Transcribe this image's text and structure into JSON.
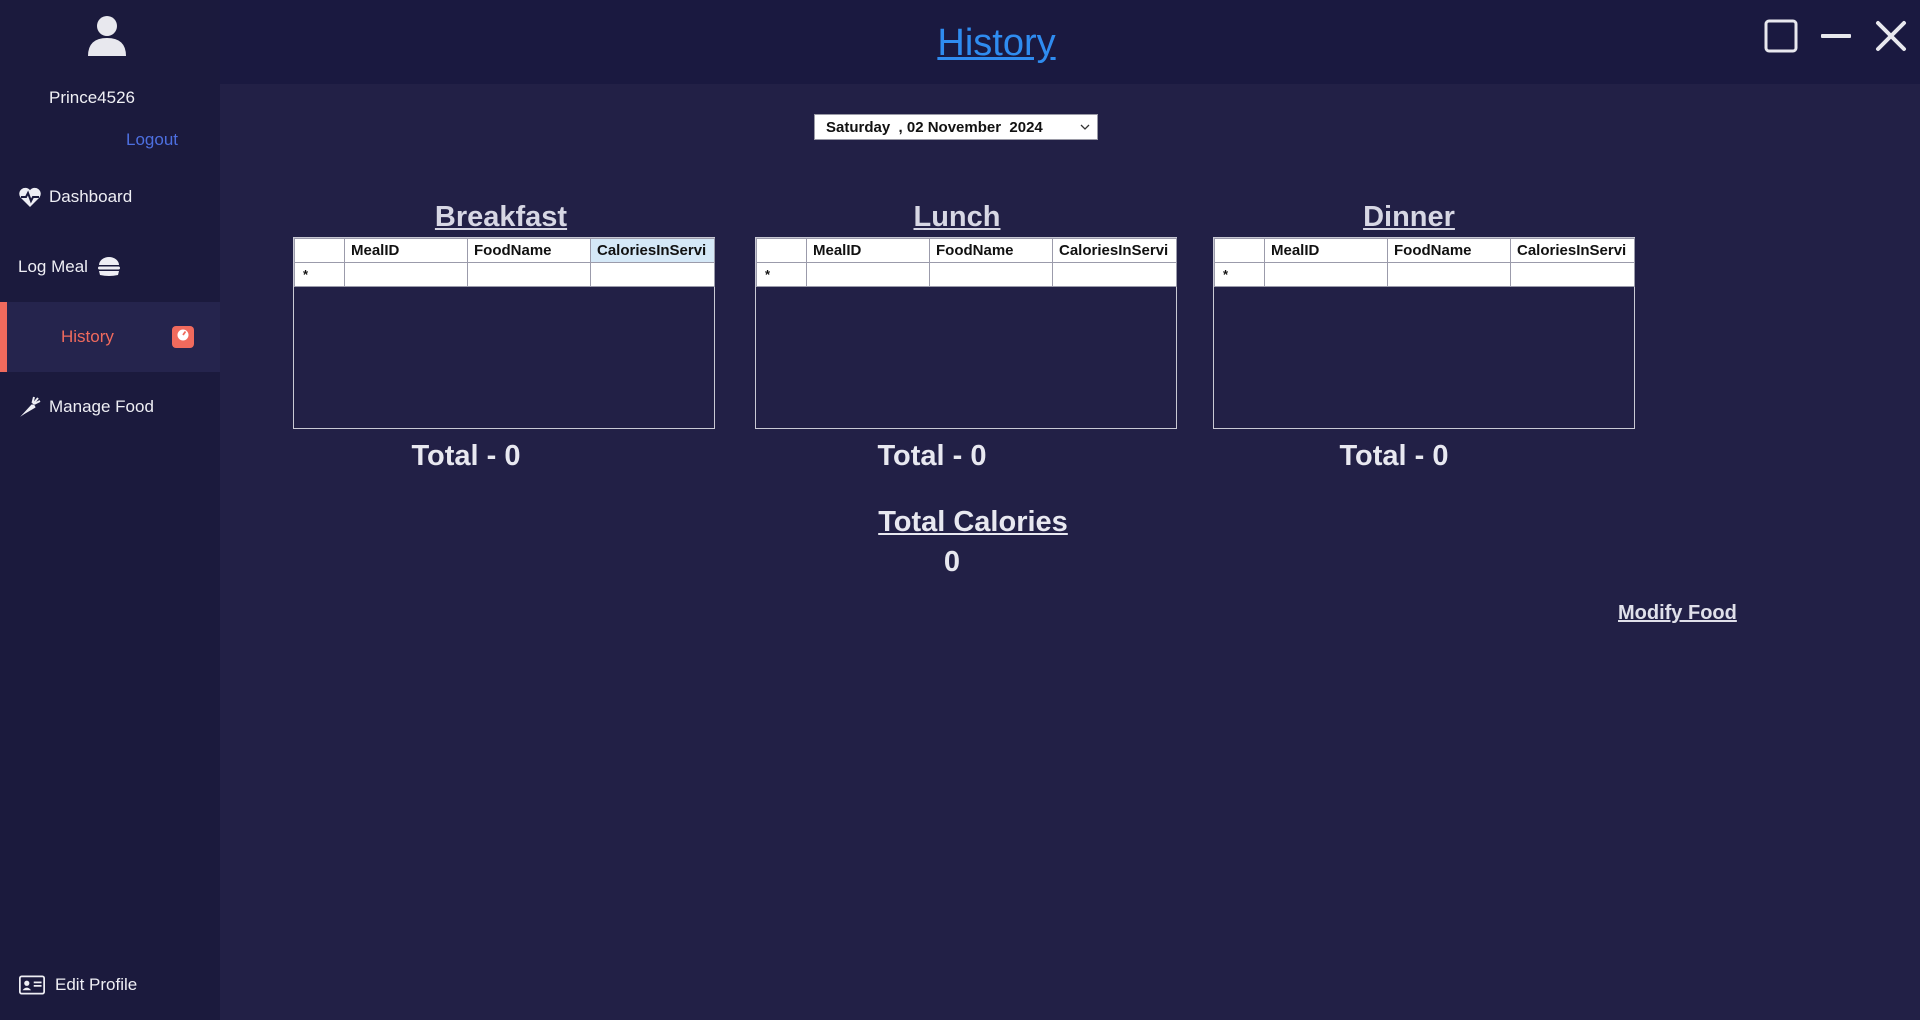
{
  "sidebar": {
    "username": "Prince4526",
    "logout": "Logout",
    "items": [
      {
        "label": "Dashboard",
        "icon": "heart-pulse-icon"
      },
      {
        "label": "Log Meal",
        "icon": "burger-icon"
      },
      {
        "label": "History",
        "icon": "scale-icon",
        "active": true
      },
      {
        "label": "Manage Food",
        "icon": "carrot-icon"
      }
    ],
    "edit_profile": "Edit Profile"
  },
  "header": {
    "title": "History"
  },
  "date_picker": {
    "value": "Saturday  , 02 November  2024"
  },
  "meals": [
    {
      "title": "Breakfast",
      "columns": [
        "",
        "MealID",
        "FoodName",
        "CaloriesInServi"
      ],
      "new_row_marker": "*",
      "total": "Total - 0"
    },
    {
      "title": "Lunch",
      "columns": [
        "",
        "MealID",
        "FoodName",
        "CaloriesInServi"
      ],
      "new_row_marker": "*",
      "total": "Total - 0"
    },
    {
      "title": "Dinner",
      "columns": [
        "",
        "MealID",
        "FoodName",
        "CaloriesInServi"
      ],
      "new_row_marker": "*",
      "total": "Total - 0"
    }
  ],
  "summary": {
    "total_calories_label": "Total Calories",
    "total_calories_value": "0",
    "modify_food": "Modify Food"
  },
  "colors": {
    "background": "#222046",
    "sidebar": "#1b1a3d",
    "header": "#1a1940",
    "accent_active": "#f06a5d",
    "title_link": "#2f8cf0",
    "logout_link": "#4d6fe0"
  }
}
